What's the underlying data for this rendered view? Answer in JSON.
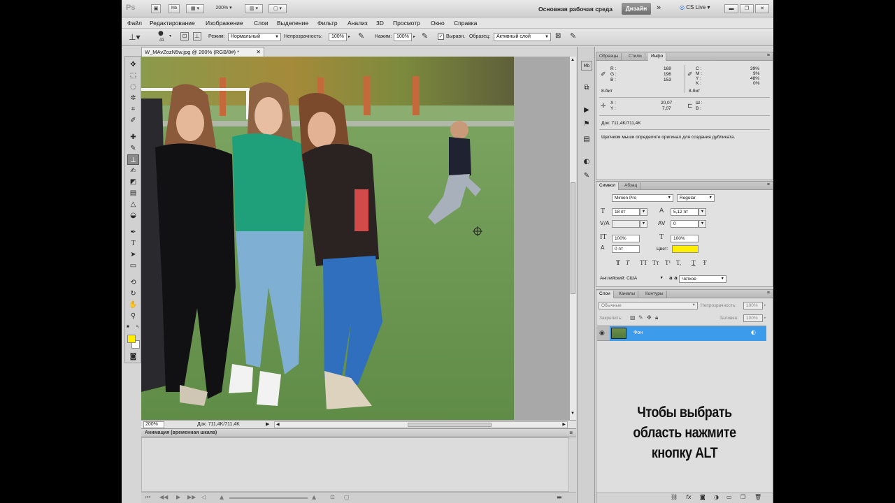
{
  "titlebar": {
    "app_logo": "Ps",
    "zoom": "200%",
    "workspace": "Основная рабочая среда",
    "design_button": "Дизайн",
    "cs_live": "CS Live"
  },
  "menu": [
    "Файл",
    "Редактирование",
    "Изображение",
    "Слои",
    "Выделение",
    "Фильтр",
    "Анализ",
    "3D",
    "Просмотр",
    "Окно",
    "Справка"
  ],
  "options": {
    "brush_size": "41",
    "mode_label": "Режим:",
    "mode_value": "Нормальный",
    "opacity_label": "Непрозрачность:",
    "opacity_value": "100%",
    "pressure_label": "Нажим:",
    "pressure_value": "100%",
    "aligned_label": "Выравн.",
    "sample_label": "Образец:",
    "sample_value": "Активный слой"
  },
  "document": {
    "tab_title": "W_MAvZozN5w.jpg @ 200% (RGB/8#) *",
    "zoom_status": "200%",
    "doc_size": "Док: 711,4K/711,4K"
  },
  "animation": {
    "title": "Анимация (временная шкала)"
  },
  "info_panel": {
    "tabs": [
      "Образцы",
      "Стили",
      "Инфо"
    ],
    "active_tab": "Инфо",
    "r_label": "R :",
    "r_value": "169",
    "g_label": "G :",
    "g_value": "196",
    "b_label": "B :",
    "b_value": "153",
    "bit1": "8-бит",
    "c_label": "C :",
    "c_value": "39%",
    "m_label": "M :",
    "m_value": "9%",
    "y_label": "Y :",
    "y_value": "48%",
    "k_label": "K :",
    "k_value": "0%",
    "bit2": "8-бит",
    "x_label": "X :",
    "x_value": "20,07",
    "y2_label": "Y :",
    "y2_value": "7,07",
    "w_label": "Ш :",
    "h_label": "В :",
    "doc": "Док: 711,4K/711,4K",
    "hint": "Щелчком мыши определите оригинал для создания дубликата."
  },
  "char_panel": {
    "tabs": [
      "Символ",
      "Абзац"
    ],
    "font_family": "Minion Pro",
    "font_style": "Regular",
    "font_size": "18 пт",
    "leading": "5,12 пт",
    "kerning": "",
    "tracking": "0",
    "vscale": "100%",
    "hscale": "100%",
    "baseline": "0 пт",
    "color_label": "Цвет:",
    "color_swatch": "#ffee00",
    "styles": [
      "T",
      "T",
      "TT",
      "Tт",
      "T¹",
      "T,",
      "T",
      "Ŧ"
    ],
    "language": "Английский: США",
    "aa_icon": "a a",
    "antialias": "Четкое"
  },
  "layers_panel": {
    "tabs": [
      "Слои",
      "Каналы",
      "Контуры"
    ],
    "blend_mode": "Обычные",
    "opacity_label": "Непрозрачность:",
    "opacity_value": "100%",
    "lock_label": "Закрепить:",
    "fill_label": "Заливка:",
    "fill_value": "100%",
    "layer_name": "Фон"
  },
  "overlay": {
    "line1": "Чтобы выбрать",
    "line2": "область нажмите",
    "line3": "кнопку ALT"
  },
  "colors": {
    "foreground": "#ffee00",
    "background": "#ffffff",
    "layer_selected": "#3c9bea"
  }
}
